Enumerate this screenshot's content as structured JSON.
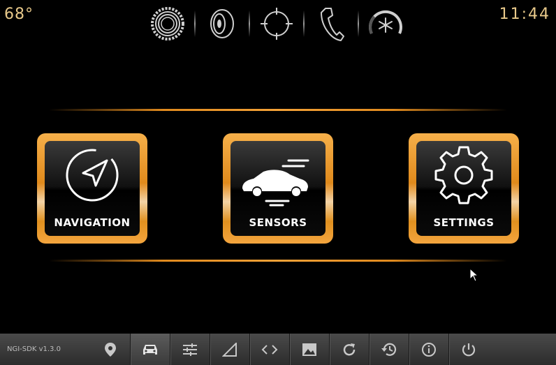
{
  "status": {
    "temperature": "68°",
    "clock": "11:44"
  },
  "top_icons": [
    "gear-ring-icon",
    "speaker-icon",
    "compass-target-icon",
    "phone-icon",
    "climate-fan-icon"
  ],
  "tiles": [
    {
      "label": "NAVIGATION",
      "icon": "navigation-arrow-icon"
    },
    {
      "label": "SENSORS",
      "icon": "car-speed-icon"
    },
    {
      "label": "SETTINGS",
      "icon": "gear-icon"
    }
  ],
  "bottom_bar": {
    "version": "NGI-SDK v1.3.0",
    "icons": [
      "location-pin-icon",
      "car-icon",
      "sliders-icon",
      "signal-triangle-icon",
      "code-brackets-icon",
      "image-icon",
      "refresh-icon",
      "history-icon",
      "info-icon",
      "power-icon"
    ]
  },
  "colors": {
    "accent": "#e08a1e",
    "text_accent": "#e8c98a",
    "bar": "#3a3a3a"
  }
}
